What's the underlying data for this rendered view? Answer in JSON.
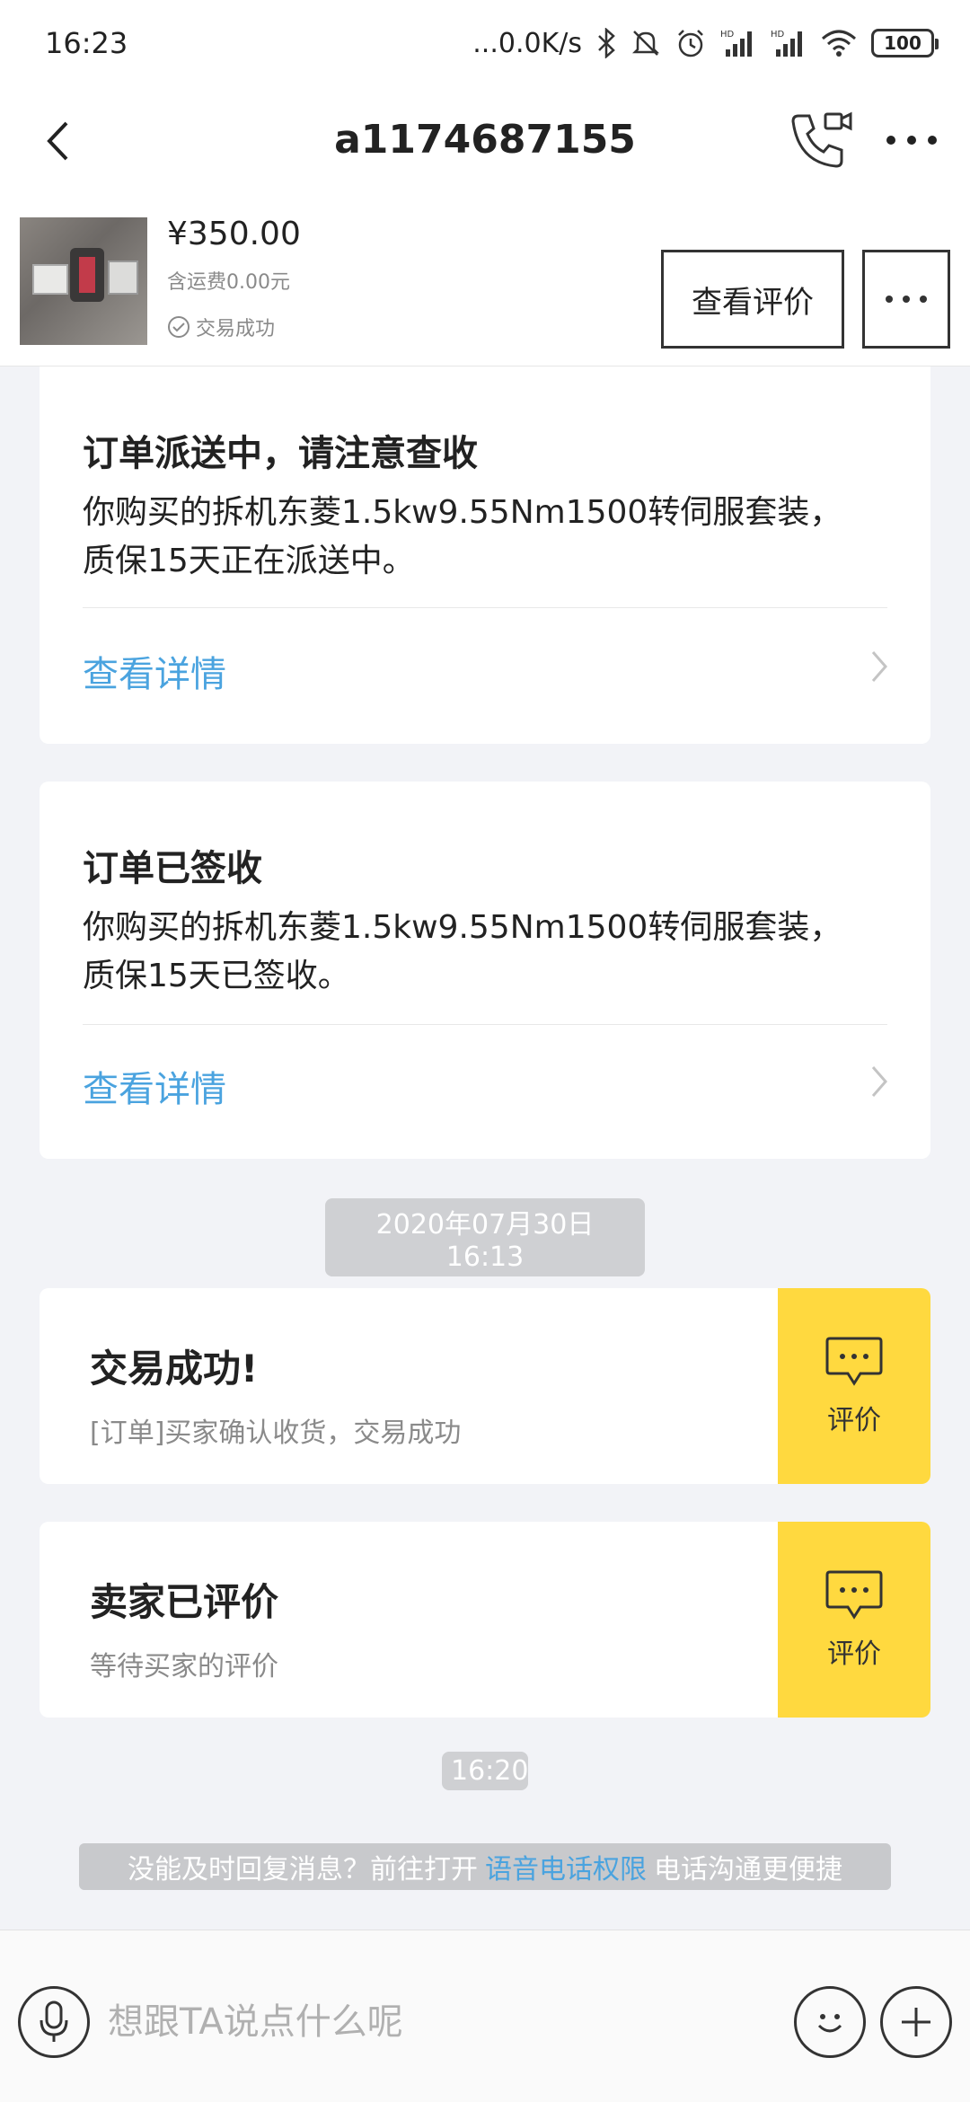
{
  "status_bar": {
    "time": "16:23",
    "net_speed": "...0.0K/s",
    "battery": "100"
  },
  "nav": {
    "title": "a1174687155"
  },
  "product": {
    "price": "¥350.00",
    "shipping": "含运费0.00元",
    "status": "交易成功",
    "review_button": "查看评价"
  },
  "cards": [
    {
      "title": "订单派送中，请注意查收",
      "body_line1": "你购买的拆机东菱1.5kw9.55Nm1500转伺服套装，",
      "body_line2": "质保15天正在派送中。",
      "link": "查看详情"
    },
    {
      "title": "订单已签收",
      "body_line1": "你购买的拆机东菱1.5kw9.55Nm1500转伺服套装，",
      "body_line2": "质保15天已签收。",
      "link": "查看详情"
    }
  ],
  "timestamp1": "2020年07月30日 16:13",
  "messages": [
    {
      "title": "交易成功!",
      "subtitle": "[订单]买家确认收货，交易成功",
      "action": "评价"
    },
    {
      "title": "卖家已评价",
      "subtitle": "等待买家的评价",
      "action": "评价"
    }
  ],
  "timestamp2": "16:20",
  "notice": {
    "prefix": "没能及时回复消息？前往打开",
    "link": "语音电话权限",
    "suffix": "电话沟通更便捷"
  },
  "input": {
    "placeholder": "想跟TA说点什么呢"
  },
  "colors": {
    "accent_blue": "#4aa3df",
    "action_yellow": "#ffd93f",
    "background": "#f2f3f7"
  }
}
